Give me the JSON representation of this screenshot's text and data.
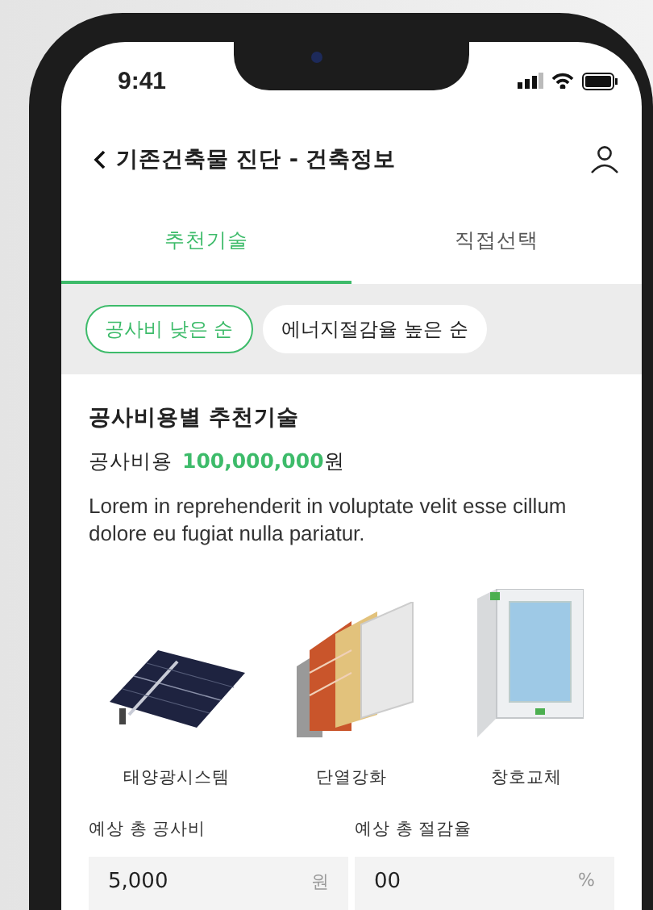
{
  "status_bar": {
    "time": "9:41"
  },
  "header": {
    "title": "기존건축물 진단 - 건축정보"
  },
  "tabs": [
    {
      "label": "추천기술",
      "selected": true
    },
    {
      "label": "직접선택",
      "selected": false
    }
  ],
  "sort_chips": [
    {
      "label": "공사비 낮은 순",
      "selected": true
    },
    {
      "label": "에너지절감율 높은 순",
      "selected": false
    }
  ],
  "section": {
    "title": "공사비용별 추천기술",
    "cost_label": "공사비용",
    "cost_value": "100,000,000",
    "cost_unit": "원",
    "description": "Lorem in reprehenderit in voluptate velit esse cillum dolore eu fugiat nulla pariatur."
  },
  "technologies": [
    {
      "kind": "solar",
      "label": "태양광시스템"
    },
    {
      "kind": "insulation",
      "label": "단열강화"
    },
    {
      "kind": "window",
      "label": "창호교체"
    }
  ],
  "estimates": [
    {
      "label": "예상 총 공사비",
      "value": "5,000",
      "unit": "원"
    },
    {
      "label": "예상 총 절감율",
      "value": "00",
      "unit": "%"
    }
  ]
}
